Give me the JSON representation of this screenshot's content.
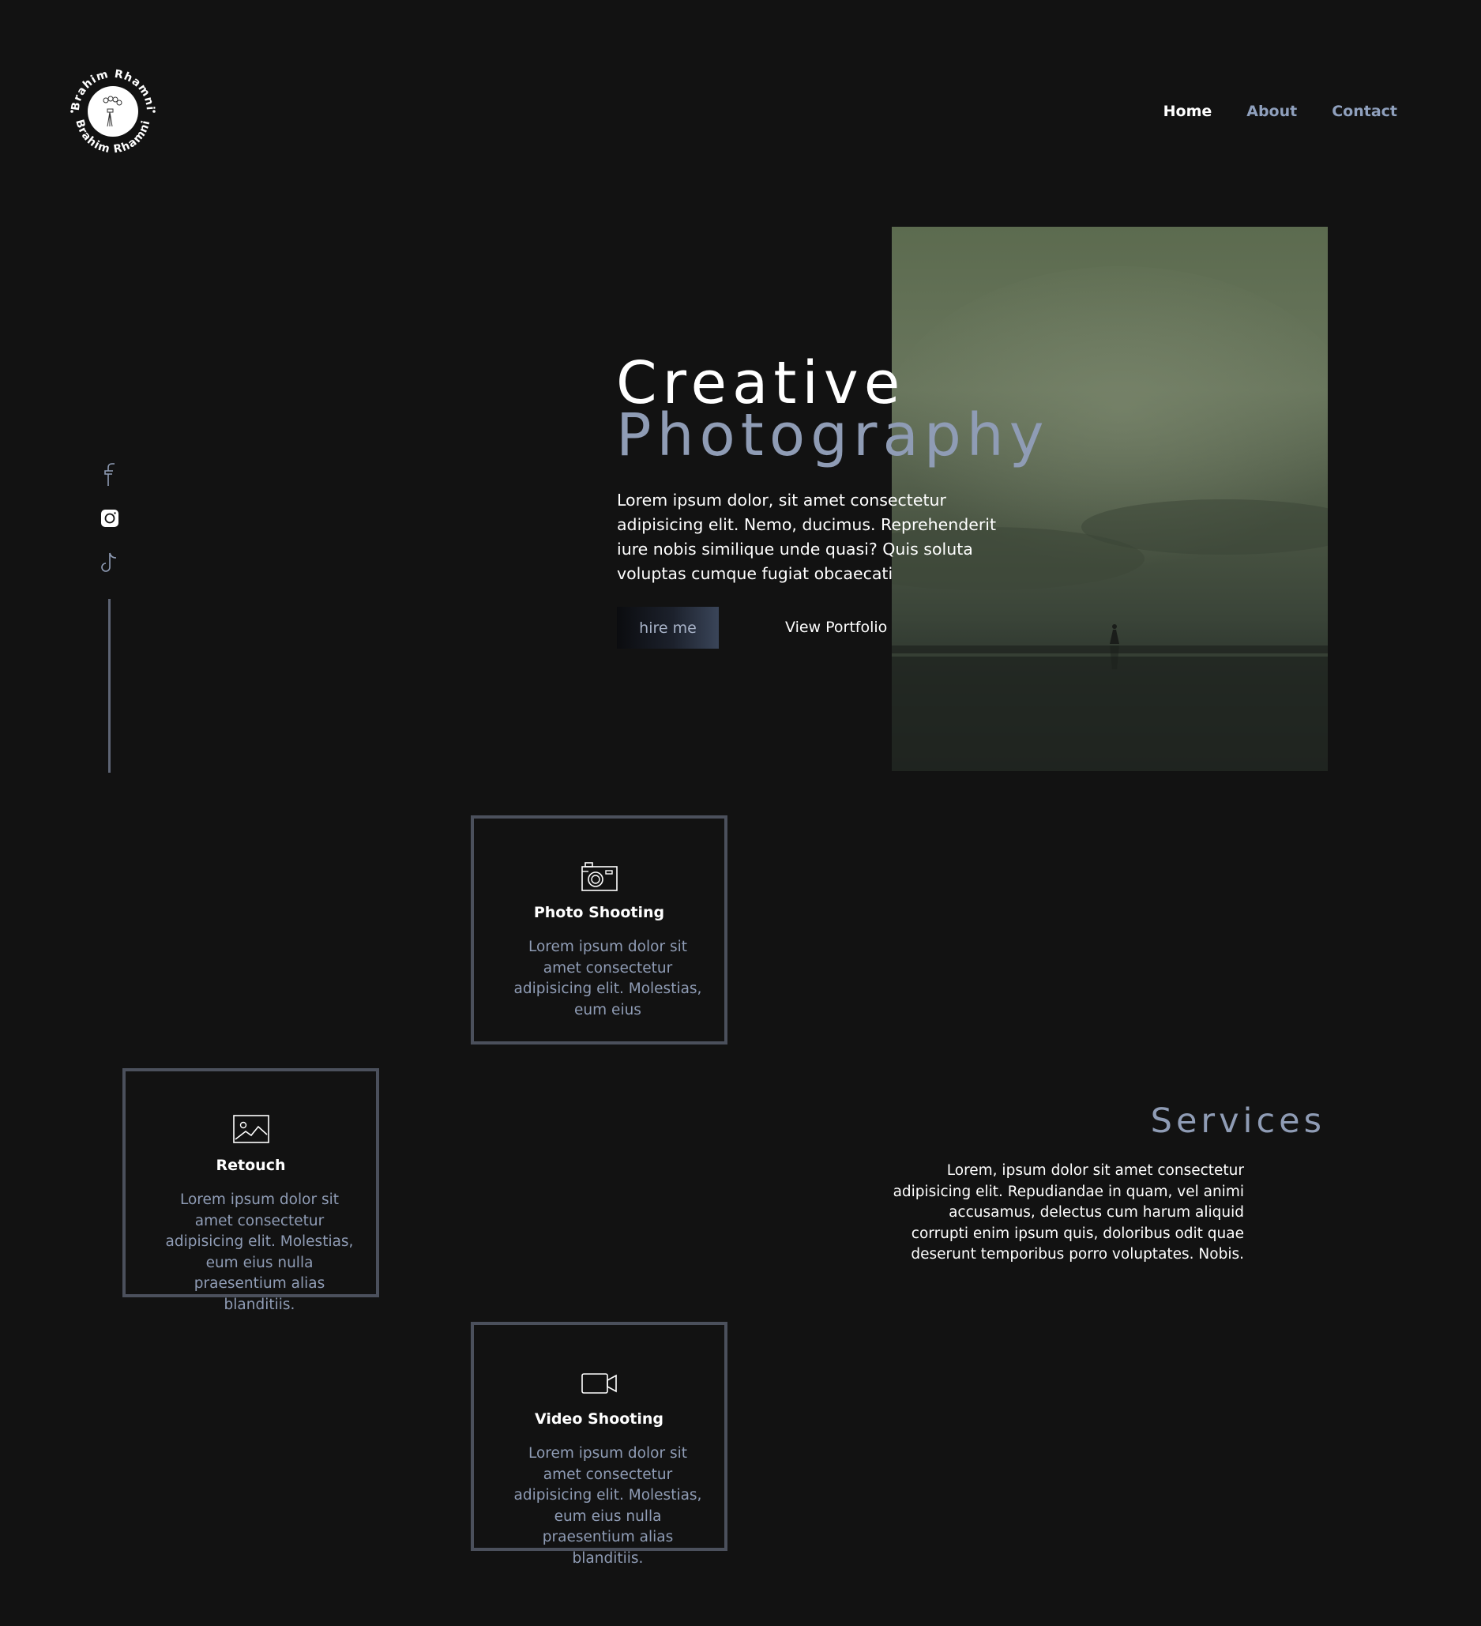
{
  "brand": {
    "name": "Brahim Rhamni"
  },
  "nav": {
    "items": [
      {
        "label": "Home",
        "active": true
      },
      {
        "label": "About",
        "active": false
      },
      {
        "label": "Contact",
        "active": false
      }
    ]
  },
  "social": {
    "icons": [
      "facebook-icon",
      "instagram-icon",
      "tiktok-icon"
    ]
  },
  "hero": {
    "title_line1": "Creative",
    "title_line2": "Photography",
    "text": "Lorem ipsum dolor, sit amet consectetur adipisicing elit. Nemo, ducimus. Reprehenderit iure nobis similique unde quasi? Quis soluta voluptas cumque fugiat obcaecati",
    "hire_label": "hire me",
    "portfolio_label": "View Portfolio"
  },
  "services": {
    "title": "Services",
    "text": "Lorem, ipsum dolor sit amet consectetur adipisicing elit. Repudiandae in quam, vel animi accusamus, delectus cum harum aliquid corrupti enim ipsum quis, doloribus odit quae deserunt temporibus porro voluptates. Nobis.",
    "cards": [
      {
        "icon": "camera-icon",
        "title": "Photo Shooting",
        "text": "Lorem ipsum dolor sit amet consectetur adipisicing elit. Molestias, eum eius"
      },
      {
        "icon": "image-icon",
        "title": "Retouch",
        "text": "Lorem ipsum dolor sit amet consectetur adipisicing elit. Molestias, eum eius nulla praesentium alias blanditiis."
      },
      {
        "icon": "video-camera-icon",
        "title": "Video Shooting",
        "text": "Lorem ipsum dolor sit amet consectetur adipisicing elit. Molestias, eum eius nulla praesentium alias blanditiis."
      }
    ]
  },
  "colors": {
    "background": "#121212",
    "accent": "#8f9cb5",
    "text": "#ffffff",
    "card_border": "#4b505c"
  }
}
